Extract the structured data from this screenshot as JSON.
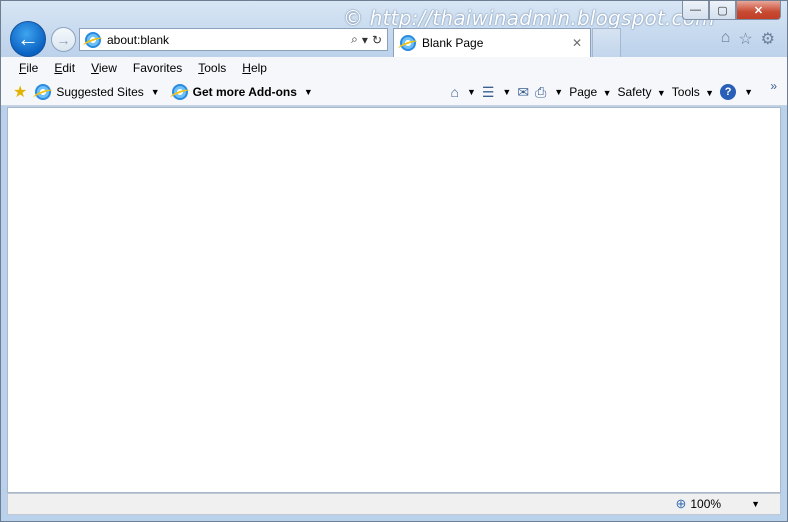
{
  "watermark": "© http://thaiwinadmin.blogspot.com",
  "nav": {
    "back_glyph": "←",
    "forward_glyph": "→",
    "address": "about:blank",
    "search_glyph": "⌕",
    "dropdown_glyph": "▾",
    "refresh_glyph": "↻"
  },
  "tab": {
    "title": "Blank Page",
    "close_glyph": "✕"
  },
  "right_icons": {
    "home": "⌂",
    "favorites": "☆",
    "tools": "⚙"
  },
  "window_controls": {
    "minimize": "—",
    "maximize": "▢",
    "close": "✕"
  },
  "menu": {
    "items": [
      {
        "accel": "F",
        "rest": "ile"
      },
      {
        "accel": "E",
        "rest": "dit"
      },
      {
        "accel": "V",
        "rest": "iew"
      },
      {
        "accel": "F",
        "rest": "avorites",
        "prefix": ""
      },
      {
        "accel": "T",
        "rest": "ools"
      },
      {
        "accel": "H",
        "rest": "elp"
      }
    ]
  },
  "favorites_bar": {
    "star_glyph": "★",
    "suggested": "Suggested Sites",
    "addons": "Get more Add-ons",
    "caret": "▼"
  },
  "command_bar": {
    "home_glyph": "⌂",
    "feeds_glyph": "☰",
    "mail_glyph": "✉",
    "print_glyph": "⎙",
    "page": "Page",
    "safety": "Safety",
    "tools": "Tools",
    "help_glyph": "?",
    "caret": "▼",
    "overflow_glyph": "»"
  },
  "status": {
    "zoom_icon": "⊕",
    "zoom": "100%",
    "caret": "▼"
  }
}
